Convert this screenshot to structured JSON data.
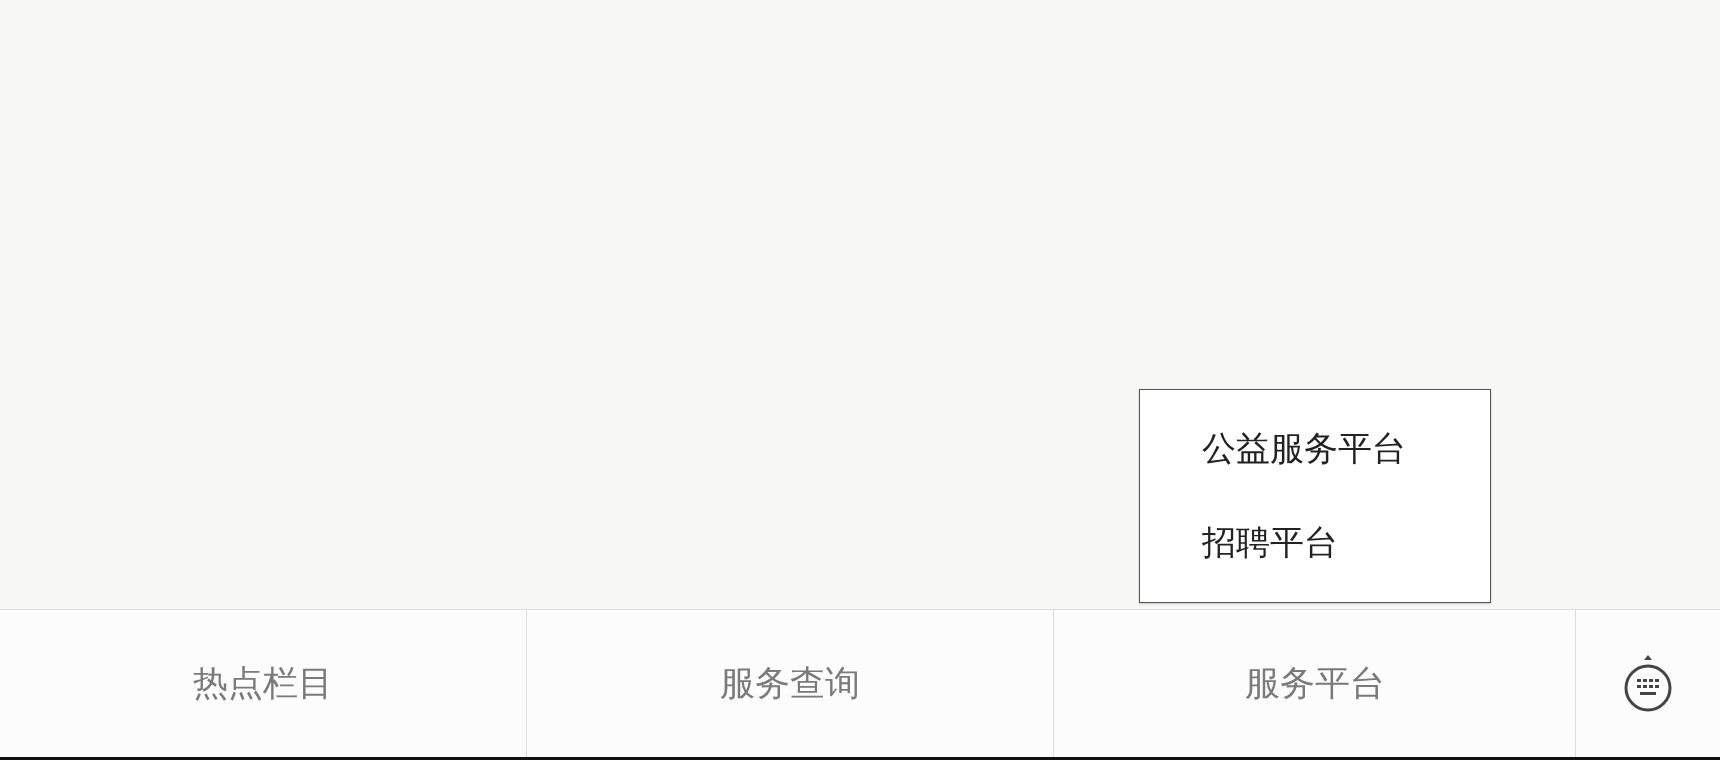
{
  "menu": [
    {
      "label": "热点栏目"
    },
    {
      "label": "服务查询"
    },
    {
      "label": "服务平台",
      "submenu": [
        "公益服务平台",
        "招聘平台"
      ]
    }
  ]
}
